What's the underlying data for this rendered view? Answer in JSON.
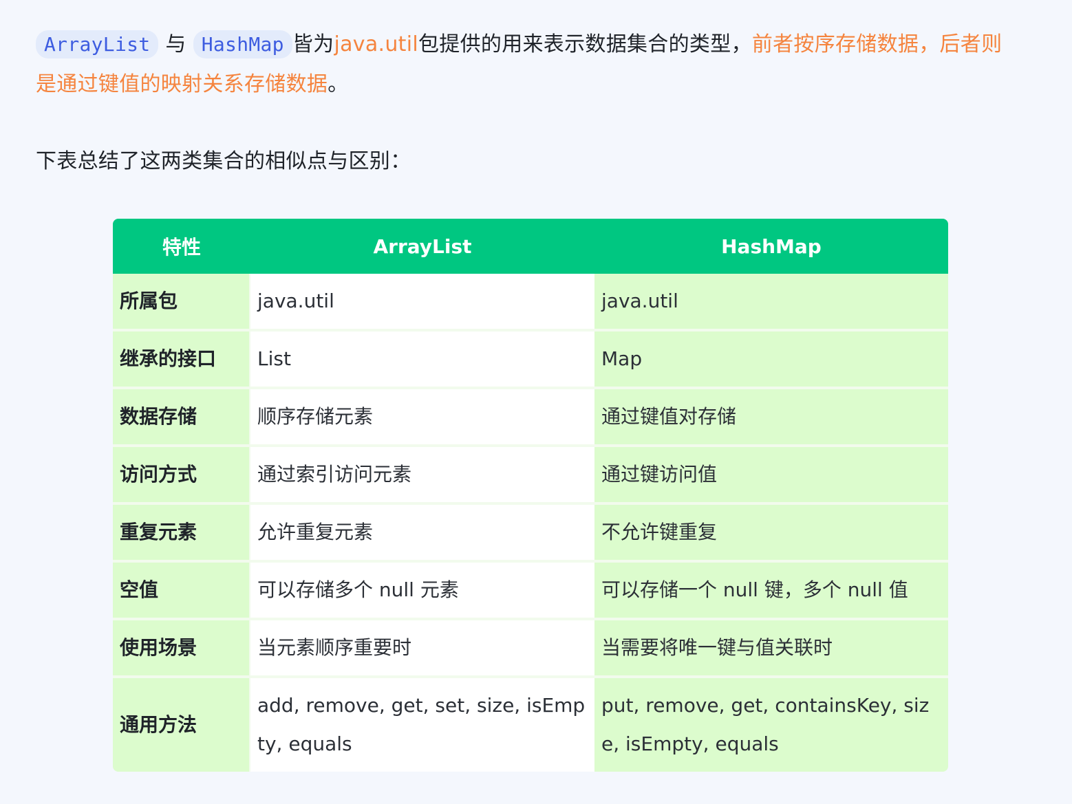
{
  "intro": {
    "code1": "ArrayList",
    "sep": "与",
    "code2": "HashMap",
    "text1": "皆为",
    "pkg": "java.util",
    "text2": "包提供的用来表示数据集合的类型，",
    "highlight": "前者按序存储数据，后者则是通过键值的映射关系存储数据",
    "end": "。"
  },
  "summary": "下表总结了这两类集合的相似点与区别：",
  "colors": {
    "header_bg": "#00c781",
    "highlight": "#f5843e",
    "code_text": "#3d5ce0",
    "row_green": "#dcfccd"
  },
  "table": {
    "headers": [
      "特性",
      "ArrayList",
      "HashMap"
    ],
    "rows": [
      {
        "feature": "所属包",
        "arraylist": "java.util",
        "hashmap": "java.util"
      },
      {
        "feature": "继承的接口",
        "arraylist": "List",
        "hashmap": "Map"
      },
      {
        "feature": "数据存储",
        "arraylist": "顺序存储元素",
        "hashmap": "通过键值对存储"
      },
      {
        "feature": "访问方式",
        "arraylist": "通过索引访问元素",
        "hashmap": "通过键访问值"
      },
      {
        "feature": "重复元素",
        "arraylist": "允许重复元素",
        "hashmap": "不允许键重复"
      },
      {
        "feature": "空值",
        "arraylist": "可以存储多个 null 元素",
        "hashmap": "可以存储一个 null 键，多个 null 值"
      },
      {
        "feature": "使用场景",
        "arraylist": "当元素顺序重要时",
        "hashmap": "当需要将唯一键与值关联时"
      },
      {
        "feature": "通用方法",
        "arraylist": "add, remove, get, set, size, isEmpty, equals",
        "hashmap": "put, remove, get, containsKey, size, isEmpty, equals"
      }
    ]
  }
}
